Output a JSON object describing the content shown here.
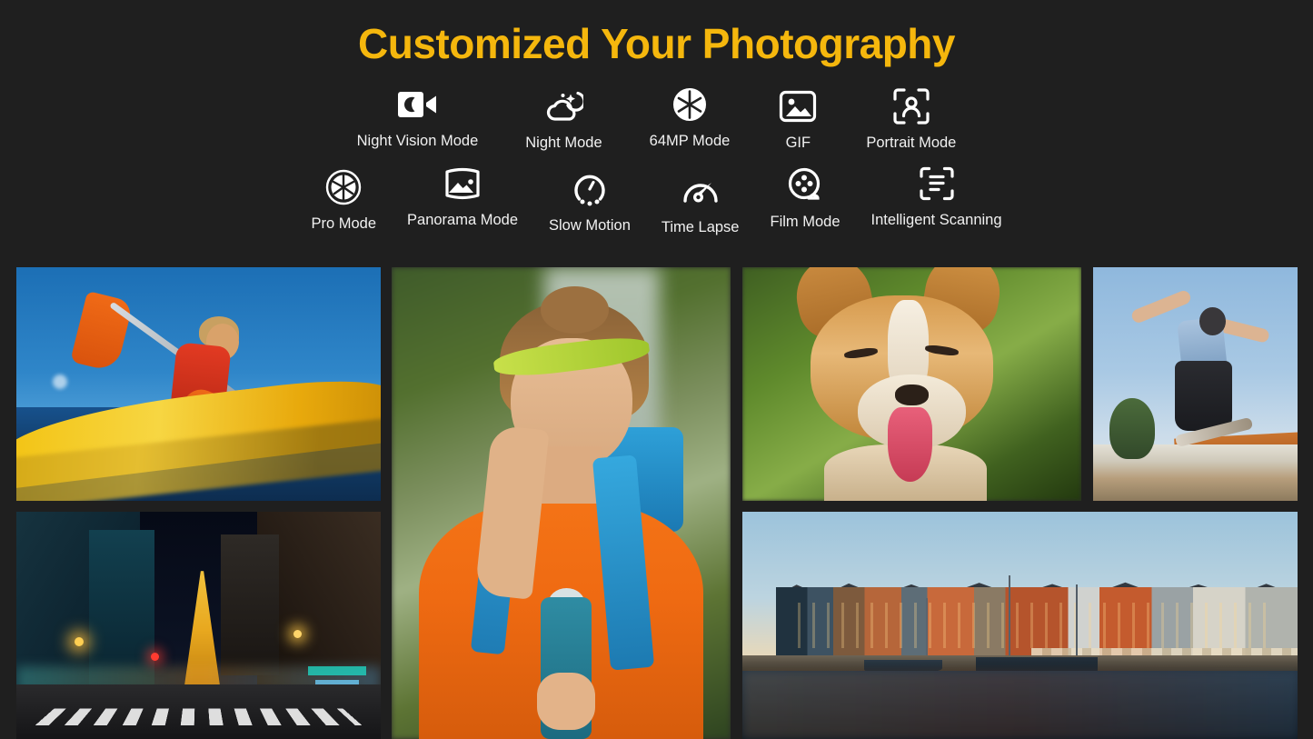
{
  "theme": {
    "background": "#1f1f1f",
    "title_color": "#f5b70d",
    "text_color": "#f1f1f1"
  },
  "header": {
    "title": "Customized Your Photography"
  },
  "modes": {
    "row1": [
      {
        "icon": "night-vision-icon",
        "label": "Night Vision Mode"
      },
      {
        "icon": "night-mode-icon",
        "label": "Night Mode"
      },
      {
        "icon": "aperture-solid-icon",
        "label": "64MP Mode"
      },
      {
        "icon": "image-frame-icon",
        "label": "GIF"
      },
      {
        "icon": "portrait-frame-icon",
        "label": "Portrait Mode"
      }
    ],
    "row2": [
      {
        "icon": "aperture-outline-icon",
        "label": "Pro Mode"
      },
      {
        "icon": "panorama-icon",
        "label": "Panorama Mode"
      },
      {
        "icon": "slow-motion-icon",
        "label": "Slow Motion"
      },
      {
        "icon": "speedometer-icon",
        "label": "Time Lapse"
      },
      {
        "icon": "film-reel-icon",
        "label": "Film Mode"
      },
      {
        "icon": "document-scan-icon",
        "label": "Intelligent Scanning"
      }
    ]
  },
  "gallery": {
    "photos": [
      {
        "name": "photo-kayaking",
        "alt": "Woman paddling a yellow kayak with an orange paddle on blue water"
      },
      {
        "name": "photo-portrait-hiker",
        "alt": "Portrait of a woman in an orange sweater with a blue backpack holding a water bottle"
      },
      {
        "name": "photo-corgi-dog",
        "alt": "Corgi dog with tongue out in green grass"
      },
      {
        "name": "photo-skateboarder",
        "alt": "Skateboarder mid-air jump against a blue sky"
      },
      {
        "name": "photo-night-city-street",
        "alt": "Night city street with illuminated tower and crosswalk"
      },
      {
        "name": "photo-harbour-canal",
        "alt": "Colorful waterfront houses and boats reflected in a calm canal at dusk"
      }
    ]
  }
}
